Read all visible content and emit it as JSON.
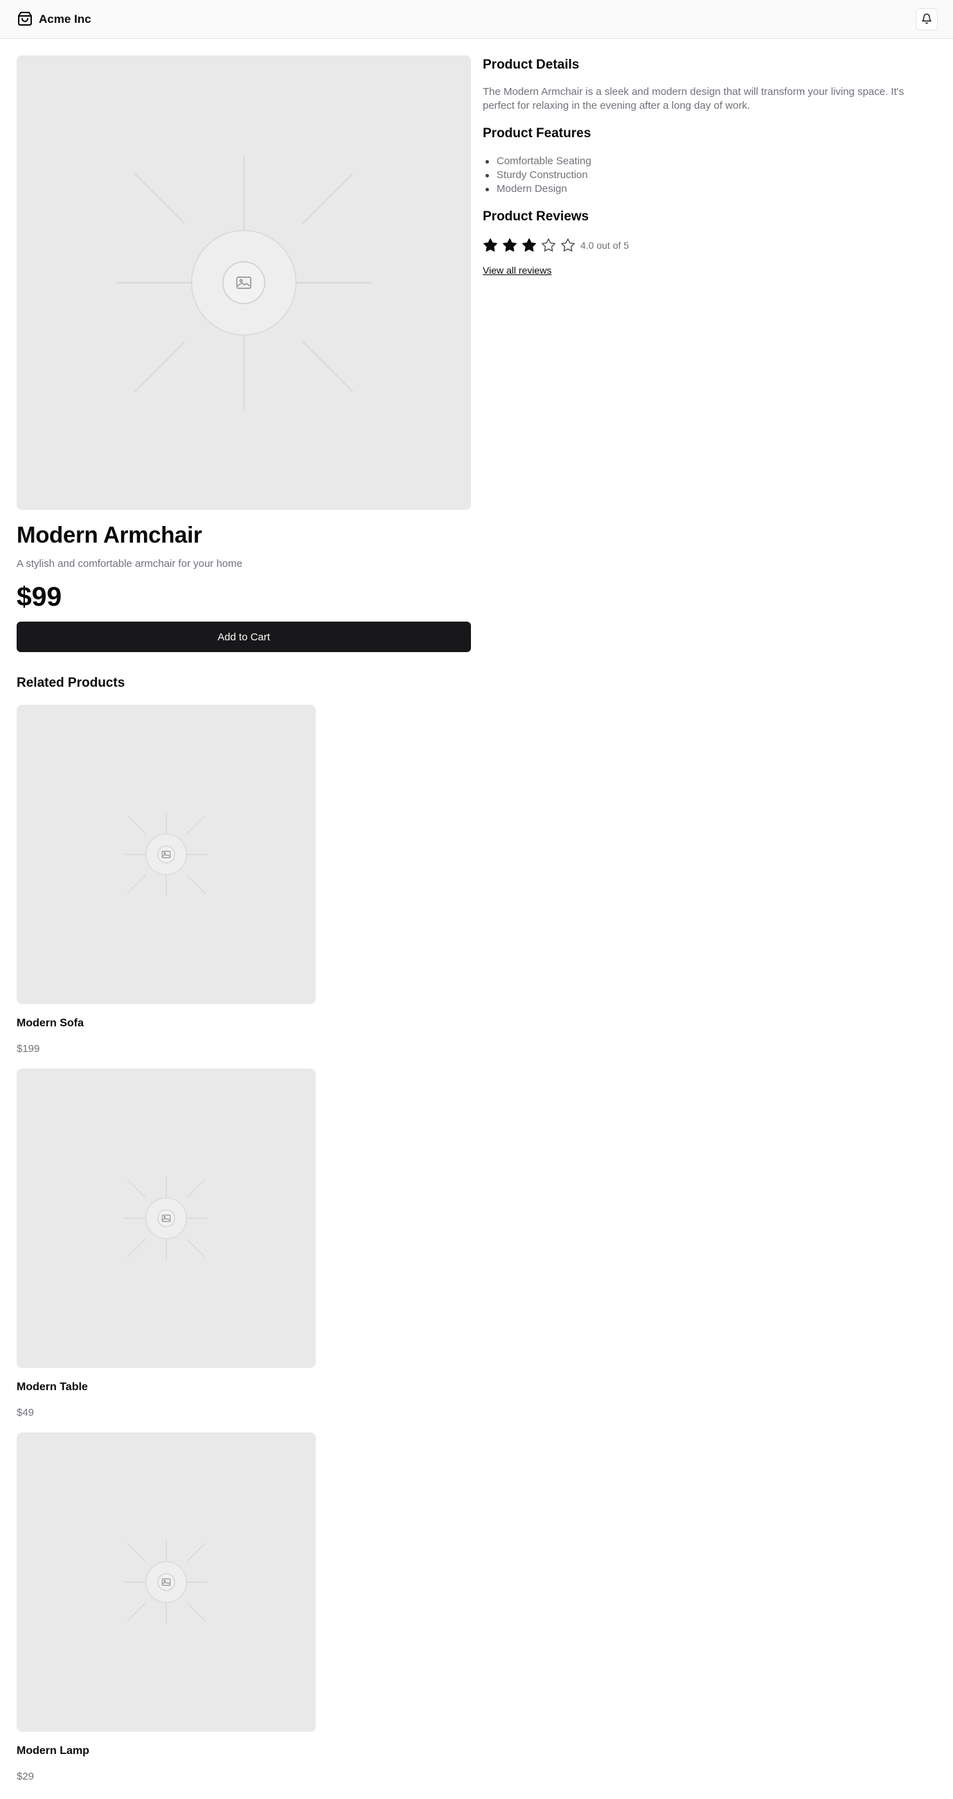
{
  "header": {
    "brand_name": "Acme Inc",
    "brand_icon": "shopping-bag-icon",
    "notification_icon": "bell-icon"
  },
  "product": {
    "image_icon": "image-placeholder-icon",
    "title": "Modern Armchair",
    "subtitle": "A stylish and comfortable armchair for your home",
    "price": "$99",
    "add_to_cart_label": "Add to Cart"
  },
  "details": {
    "heading": "Product Details",
    "description": "The Modern Armchair is a sleek and modern design that will transform your living space. It's perfect for relaxing in the evening after a long day of work."
  },
  "features": {
    "heading": "Product Features",
    "items": [
      "Comfortable Seating",
      "Sturdy Construction",
      "Modern Design"
    ]
  },
  "reviews": {
    "heading": "Product Reviews",
    "rating": 3,
    "max_rating": 5,
    "rating_text": "4.0 out of 5",
    "view_all_label": "View all reviews"
  },
  "related": {
    "heading": "Related Products",
    "items": [
      {
        "name": "Modern Sofa",
        "price": "$199"
      },
      {
        "name": "Modern Table",
        "price": "$49"
      },
      {
        "name": "Modern Lamp",
        "price": "$29"
      }
    ]
  },
  "colors": {
    "primary_button": "#18181b",
    "muted_text": "#71717a",
    "placeholder_bg": "#e9e9e9",
    "star_filled": "#09090b"
  }
}
